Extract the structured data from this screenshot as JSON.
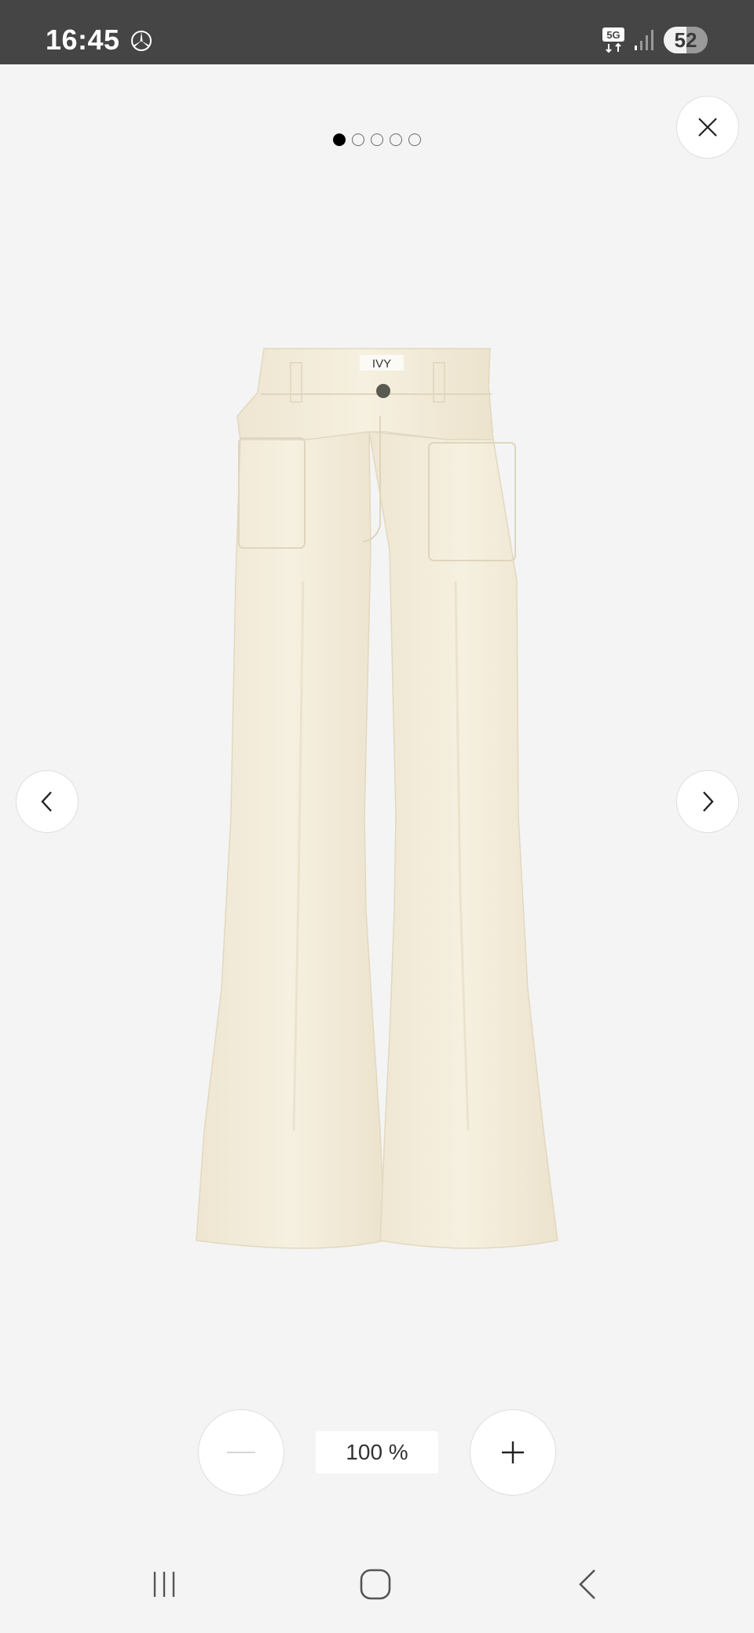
{
  "status_bar": {
    "time": "16:45",
    "network": "5G",
    "battery": "52",
    "battery_level": 0.52
  },
  "gallery": {
    "image_count": 5,
    "active_index": 0,
    "brand_label": "IVY",
    "product_color": "#f0e9d6"
  },
  "icons": {
    "close": "close-icon",
    "prev": "chevron-left-icon",
    "next": "chevron-right-icon",
    "zoom_out": "minus-icon",
    "zoom_in": "plus-icon",
    "carrier": "mercedes-star-icon"
  },
  "zoom": {
    "value": "100 %"
  },
  "nav": {
    "recent": "recent-apps-icon",
    "home": "home-icon",
    "back": "back-icon"
  }
}
